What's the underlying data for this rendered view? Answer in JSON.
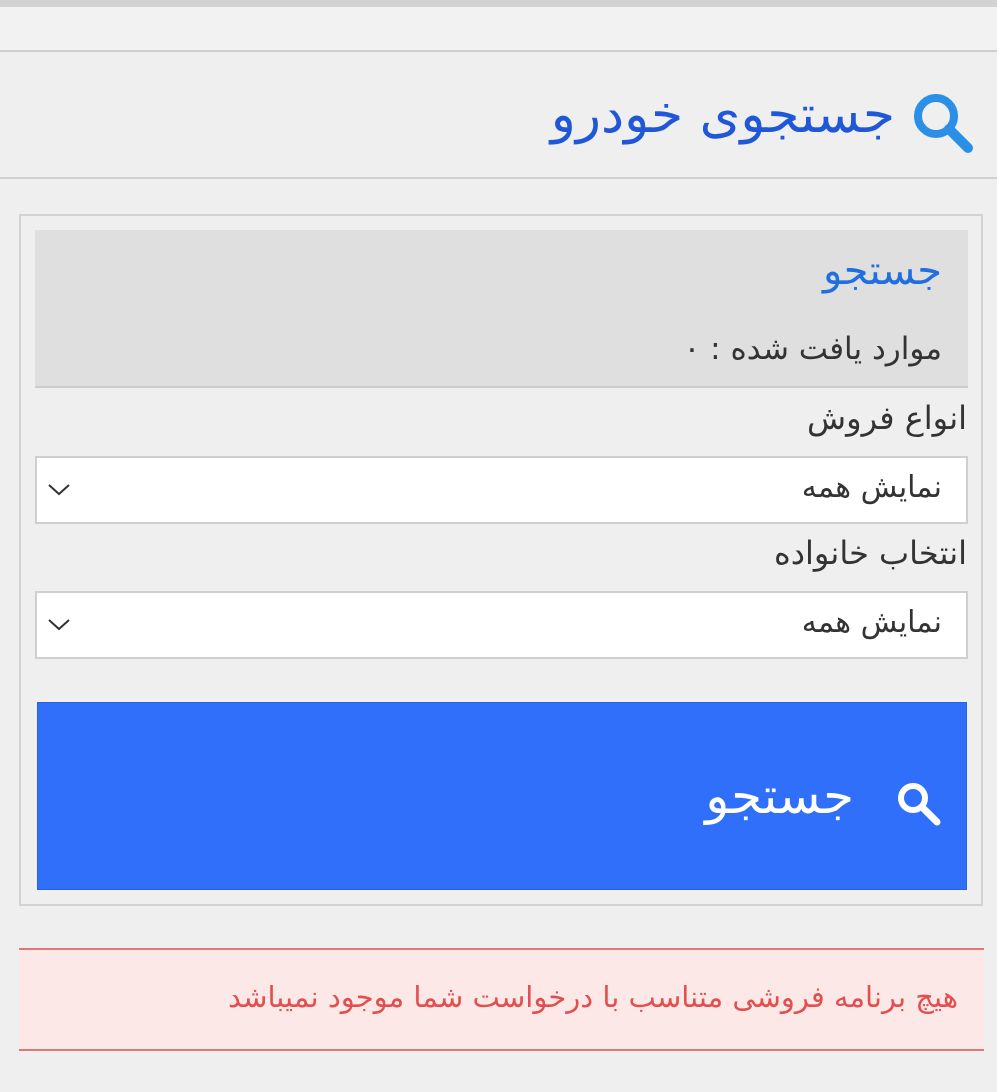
{
  "page": {
    "title": "جستجوی خودرو",
    "icons": {
      "title": "search-icon",
      "select": "chevron-down-icon",
      "button": "search-icon"
    },
    "colors": {
      "title": "#1f57d6",
      "button": "#2f6ff9",
      "alert_text": "#e14f4f",
      "alert_bg": "#fde8e8"
    }
  },
  "results": {
    "title": "جستجو",
    "count_label": "موارد یافت شده : ۰"
  },
  "filters": {
    "sale_types": {
      "label": "انواع فروش",
      "selected": "نمایش همه"
    },
    "family": {
      "label": "انتخاب خانواده",
      "selected": "نمایش همه"
    }
  },
  "search_button": {
    "label": "جستجو"
  },
  "alert": {
    "message": "هیچ برنامه فروشی متناسب با درخواست شما موجود نمیباشد"
  }
}
